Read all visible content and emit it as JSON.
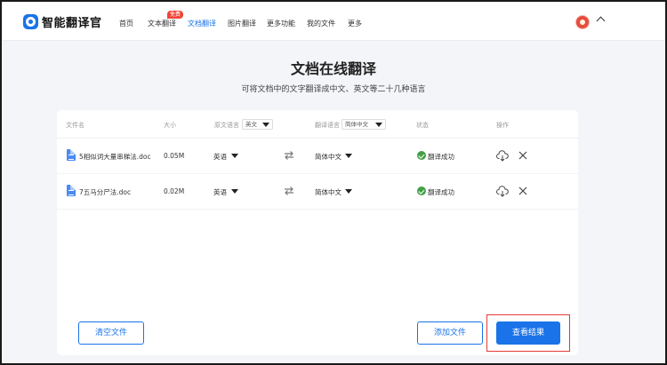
{
  "header": {
    "logo_text": "智能翻译官",
    "nav": [
      {
        "label": "首页"
      },
      {
        "label": "文本翻译",
        "badge": "免费"
      },
      {
        "label": "文档翻译",
        "active": true
      },
      {
        "label": "图片翻译"
      },
      {
        "label": "更多功能"
      },
      {
        "label": "我的文件"
      },
      {
        "label": "更多"
      }
    ]
  },
  "page": {
    "title": "文档在线翻译",
    "subtitle": "可将文档中的文字翻译成中文、英文等二十几种语言"
  },
  "table": {
    "headers": {
      "file_name": "文件名",
      "size": "大小",
      "source_lang": "原文语言",
      "source_lang_select": "英文",
      "target_lang": "翻译语言",
      "target_lang_select": "简体中文",
      "status": "状态",
      "actions": "操作"
    },
    "rows": [
      {
        "name": "5相似词大量串梯法.doc",
        "size": "0.05M",
        "source": "英语",
        "target": "简体中文",
        "status": "翻译成功"
      },
      {
        "name": "7五马分尸法.doc",
        "size": "0.02M",
        "source": "英语",
        "target": "简体中文",
        "status": "翻译成功"
      }
    ]
  },
  "buttons": {
    "clear": "清空文件",
    "add": "添加文件",
    "view_results": "查看结果"
  },
  "colors": {
    "accent": "#1a73e8",
    "success": "#43a047",
    "badge": "#f04438",
    "highlight_box": "#e53935"
  },
  "icons": [
    "logo-icon",
    "avatar",
    "chevron-up-icon",
    "document-icon",
    "swap-icon",
    "check-circle-icon",
    "cloud-download-icon",
    "close-icon"
  ]
}
